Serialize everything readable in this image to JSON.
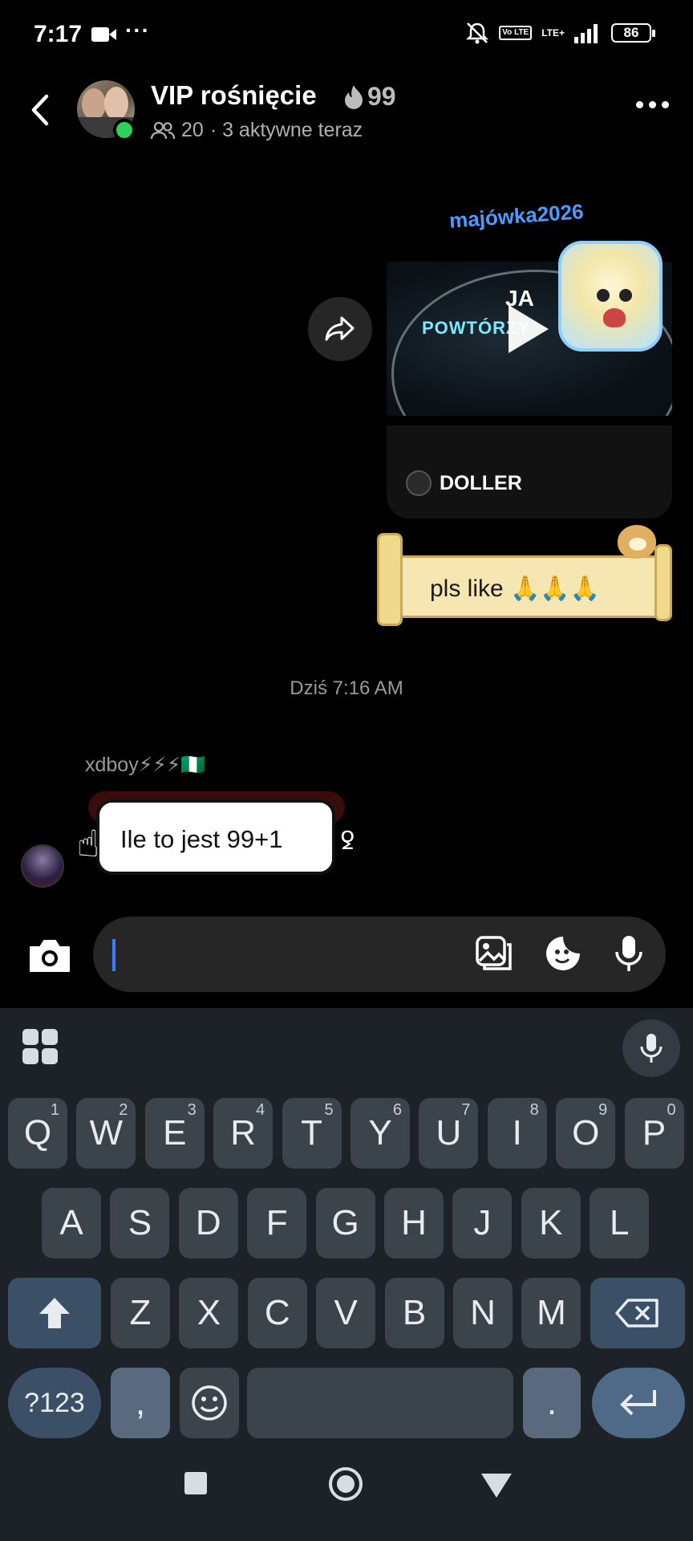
{
  "status_bar": {
    "time": "7:17",
    "dots": "···",
    "volte": "Vo LTE",
    "network": "LTE+",
    "battery": "86"
  },
  "header": {
    "title": "VIP rośnięcie",
    "streak_count": "99",
    "member_count": "20",
    "active_text": "· 3 aktywne teraz"
  },
  "messages": {
    "shared_post": {
      "overlay_text": "majówka2026",
      "video_text_1": "JA",
      "video_text_2": "POWTÓRZY",
      "author": "DOLLER"
    },
    "sticker_text": "pls like 🙏🙏🙏",
    "timestamp": "Dziś 7:16 AM",
    "incoming": {
      "sender": "xdboy⚡⚡⚡🇳🇬",
      "text": "Ile to jest 99+1"
    }
  },
  "composer": {
    "value": ""
  },
  "keyboard": {
    "row1": [
      {
        "k": "Q",
        "s": "1"
      },
      {
        "k": "W",
        "s": "2"
      },
      {
        "k": "E",
        "s": "3"
      },
      {
        "k": "R",
        "s": "4"
      },
      {
        "k": "T",
        "s": "5"
      },
      {
        "k": "Y",
        "s": "6"
      },
      {
        "k": "U",
        "s": "7"
      },
      {
        "k": "I",
        "s": "8"
      },
      {
        "k": "O",
        "s": "9"
      },
      {
        "k": "P",
        "s": "0"
      }
    ],
    "row2": [
      "A",
      "S",
      "D",
      "F",
      "G",
      "H",
      "J",
      "K",
      "L"
    ],
    "row3": [
      "Z",
      "X",
      "C",
      "V",
      "B",
      "N",
      "M"
    ],
    "symbols_label": "?123",
    "comma": ",",
    "period": "."
  },
  "colors": {
    "online": "#2ed158",
    "caret": "#3a7bff",
    "keyboard_bg": "#1c2228"
  }
}
